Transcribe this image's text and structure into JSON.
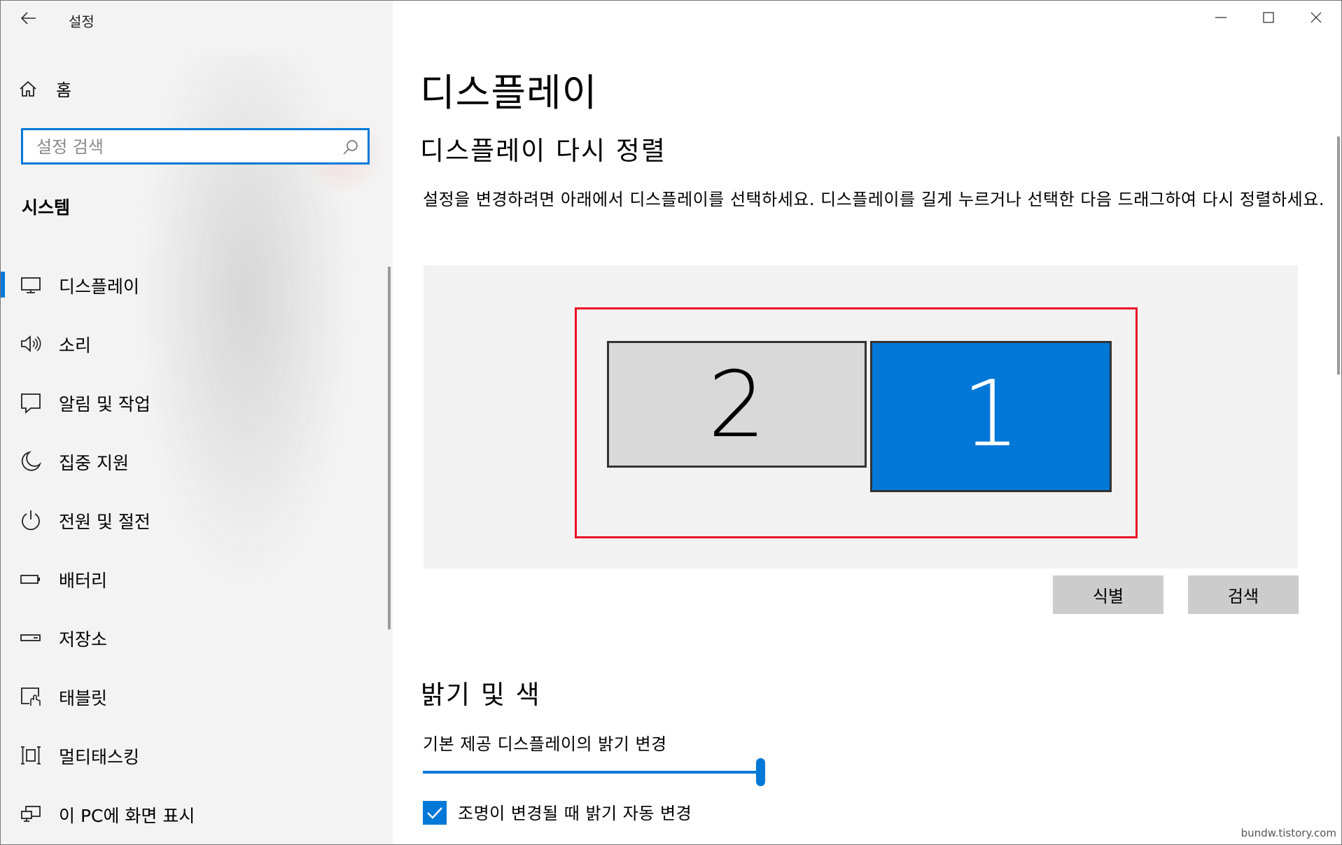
{
  "window": {
    "app_title": "설정"
  },
  "sidebar": {
    "home_label": "홈",
    "search_placeholder": "설정 검색",
    "section_title": "시스템",
    "items": [
      {
        "label": "디스플레이",
        "icon": "monitor-icon",
        "active": true
      },
      {
        "label": "소리",
        "icon": "speaker-icon"
      },
      {
        "label": "알림 및 작업",
        "icon": "notification-icon"
      },
      {
        "label": "집중 지원",
        "icon": "moon-icon"
      },
      {
        "label": "전원 및 절전",
        "icon": "power-icon"
      },
      {
        "label": "배터리",
        "icon": "battery-icon"
      },
      {
        "label": "저장소",
        "icon": "storage-icon"
      },
      {
        "label": "태블릿",
        "icon": "tablet-icon"
      },
      {
        "label": "멀티태스킹",
        "icon": "multitasking-icon"
      },
      {
        "label": "이 PC에 화면 표시",
        "icon": "project-icon"
      }
    ]
  },
  "main": {
    "page_title": "디스플레이",
    "rearrange_title": "디스플레이 다시 정렬",
    "rearrange_desc": "설정을 변경하려면 아래에서 디스플레이를 선택하세요. 디스플레이를 길게 누르거나 선택한 다음 드래그하여 다시 정렬하세요.",
    "monitors": [
      {
        "number": "2",
        "selected": false
      },
      {
        "number": "1",
        "selected": true
      }
    ],
    "identify_button": "식별",
    "detect_button": "검색",
    "brightness_title": "밝기 및 색",
    "brightness_label": "기본 제공 디스플레이의 밝기 변경",
    "brightness_value": 100,
    "auto_brightness_label": "조명이 변경될 때 밝기 자동 변경",
    "auto_brightness_checked": true
  },
  "watermark": "bundw.tistory.com",
  "colors": {
    "accent": "#0078d7",
    "highlight_frame": "#e81123",
    "sidebar_bg": "#f3f3f3"
  }
}
